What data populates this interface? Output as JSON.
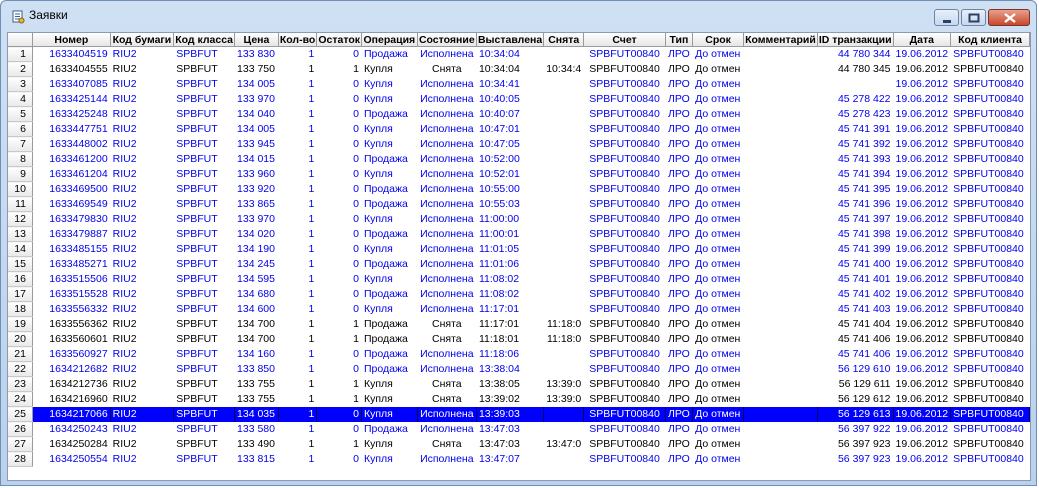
{
  "window": {
    "title": "Заявки"
  },
  "columns": [
    "",
    "Номер",
    "Код бумаги",
    "Код класса",
    "Цена",
    "Кол-во",
    "Остаток",
    "Операция",
    "Состояние",
    "Выставлена",
    "Снята",
    "Счет",
    "Тип",
    "Срок",
    "Комментарий",
    "ID транзакции",
    "Дата",
    "Код клиента"
  ],
  "rows": [
    {
      "n": "1",
      "num": "1633404519",
      "sec": "RIU2",
      "cls": "SPBFUT",
      "price": "133 830",
      "qty": "1",
      "rest": "0",
      "op": "Продажа",
      "state": "Исполнена",
      "placed": "10:34:04",
      "removed": "",
      "acc": "SPBFUT00840",
      "type": "ЛРО",
      "term": "До отмен",
      "comment": "",
      "tid": "44 780 344",
      "date": "19.06.2012",
      "client": "SPBFUT00840",
      "style": "blue"
    },
    {
      "n": "2",
      "num": "1633404555",
      "sec": "RIU2",
      "cls": "SPBFUT",
      "price": "133 750",
      "qty": "1",
      "rest": "1",
      "op": "Купля",
      "state": "Снята",
      "placed": "10:34:04",
      "removed": "10:34:4",
      "acc": "SPBFUT00840",
      "type": "ЛРО",
      "term": "До отмен",
      "comment": "",
      "tid": "44 780 345",
      "date": "19.06.2012",
      "client": "SPBFUT00840",
      "style": "black"
    },
    {
      "n": "3",
      "num": "1633407085",
      "sec": "RIU2",
      "cls": "SPBFUT",
      "price": "134 005",
      "qty": "1",
      "rest": "0",
      "op": "Купля",
      "state": "Исполнена",
      "placed": "10:34:41",
      "removed": "",
      "acc": "SPBFUT00840",
      "type": "ЛРО",
      "term": "До отмен",
      "comment": "",
      "tid": "",
      "date": "19.06.2012",
      "client": "SPBFUT00840",
      "style": "blue"
    },
    {
      "n": "4",
      "num": "1633425144",
      "sec": "RIU2",
      "cls": "SPBFUT",
      "price": "133 970",
      "qty": "1",
      "rest": "0",
      "op": "Купля",
      "state": "Исполнена",
      "placed": "10:40:05",
      "removed": "",
      "acc": "SPBFUT00840",
      "type": "ЛРО",
      "term": "До отмен",
      "comment": "",
      "tid": "45 278 422",
      "date": "19.06.2012",
      "client": "SPBFUT00840",
      "style": "blue"
    },
    {
      "n": "5",
      "num": "1633425248",
      "sec": "RIU2",
      "cls": "SPBFUT",
      "price": "134 040",
      "qty": "1",
      "rest": "0",
      "op": "Продажа",
      "state": "Исполнена",
      "placed": "10:40:07",
      "removed": "",
      "acc": "SPBFUT00840",
      "type": "ЛРО",
      "term": "До отмен",
      "comment": "",
      "tid": "45 278 423",
      "date": "19.06.2012",
      "client": "SPBFUT00840",
      "style": "blue"
    },
    {
      "n": "6",
      "num": "1633447751",
      "sec": "RIU2",
      "cls": "SPBFUT",
      "price": "134 005",
      "qty": "1",
      "rest": "0",
      "op": "Купля",
      "state": "Исполнена",
      "placed": "10:47:01",
      "removed": "",
      "acc": "SPBFUT00840",
      "type": "ЛРО",
      "term": "До отмен",
      "comment": "",
      "tid": "45 741 391",
      "date": "19.06.2012",
      "client": "SPBFUT00840",
      "style": "blue"
    },
    {
      "n": "7",
      "num": "1633448002",
      "sec": "RIU2",
      "cls": "SPBFUT",
      "price": "133 945",
      "qty": "1",
      "rest": "0",
      "op": "Купля",
      "state": "Исполнена",
      "placed": "10:47:05",
      "removed": "",
      "acc": "SPBFUT00840",
      "type": "ЛРО",
      "term": "До отмен",
      "comment": "",
      "tid": "45 741 392",
      "date": "19.06.2012",
      "client": "SPBFUT00840",
      "style": "blue"
    },
    {
      "n": "8",
      "num": "1633461200",
      "sec": "RIU2",
      "cls": "SPBFUT",
      "price": "134 015",
      "qty": "1",
      "rest": "0",
      "op": "Продажа",
      "state": "Исполнена",
      "placed": "10:52:00",
      "removed": "",
      "acc": "SPBFUT00840",
      "type": "ЛРО",
      "term": "До отмен",
      "comment": "",
      "tid": "45 741 393",
      "date": "19.06.2012",
      "client": "SPBFUT00840",
      "style": "blue"
    },
    {
      "n": "9",
      "num": "1633461204",
      "sec": "RIU2",
      "cls": "SPBFUT",
      "price": "133 960",
      "qty": "1",
      "rest": "0",
      "op": "Купля",
      "state": "Исполнена",
      "placed": "10:52:01",
      "removed": "",
      "acc": "SPBFUT00840",
      "type": "ЛРО",
      "term": "До отмен",
      "comment": "",
      "tid": "45 741 394",
      "date": "19.06.2012",
      "client": "SPBFUT00840",
      "style": "blue"
    },
    {
      "n": "10",
      "num": "1633469500",
      "sec": "RIU2",
      "cls": "SPBFUT",
      "price": "133 920",
      "qty": "1",
      "rest": "0",
      "op": "Продажа",
      "state": "Исполнена",
      "placed": "10:55:00",
      "removed": "",
      "acc": "SPBFUT00840",
      "type": "ЛРО",
      "term": "До отмен",
      "comment": "",
      "tid": "45 741 395",
      "date": "19.06.2012",
      "client": "SPBFUT00840",
      "style": "blue"
    },
    {
      "n": "11",
      "num": "1633469549",
      "sec": "RIU2",
      "cls": "SPBFUT",
      "price": "133 865",
      "qty": "1",
      "rest": "0",
      "op": "Продажа",
      "state": "Исполнена",
      "placed": "10:55:03",
      "removed": "",
      "acc": "SPBFUT00840",
      "type": "ЛРО",
      "term": "До отмен",
      "comment": "",
      "tid": "45 741 396",
      "date": "19.06.2012",
      "client": "SPBFUT00840",
      "style": "blue"
    },
    {
      "n": "12",
      "num": "1633479830",
      "sec": "RIU2",
      "cls": "SPBFUT",
      "price": "133 970",
      "qty": "1",
      "rest": "0",
      "op": "Купля",
      "state": "Исполнена",
      "placed": "11:00:00",
      "removed": "",
      "acc": "SPBFUT00840",
      "type": "ЛРО",
      "term": "До отмен",
      "comment": "",
      "tid": "45 741 397",
      "date": "19.06.2012",
      "client": "SPBFUT00840",
      "style": "blue"
    },
    {
      "n": "13",
      "num": "1633479887",
      "sec": "RIU2",
      "cls": "SPBFUT",
      "price": "134 020",
      "qty": "1",
      "rest": "0",
      "op": "Продажа",
      "state": "Исполнена",
      "placed": "11:00:01",
      "removed": "",
      "acc": "SPBFUT00840",
      "type": "ЛРО",
      "term": "До отмен",
      "comment": "",
      "tid": "45 741 398",
      "date": "19.06.2012",
      "client": "SPBFUT00840",
      "style": "blue"
    },
    {
      "n": "14",
      "num": "1633485155",
      "sec": "RIU2",
      "cls": "SPBFUT",
      "price": "134 190",
      "qty": "1",
      "rest": "0",
      "op": "Купля",
      "state": "Исполнена",
      "placed": "11:01:05",
      "removed": "",
      "acc": "SPBFUT00840",
      "type": "ЛРО",
      "term": "До отмен",
      "comment": "",
      "tid": "45 741 399",
      "date": "19.06.2012",
      "client": "SPBFUT00840",
      "style": "blue"
    },
    {
      "n": "15",
      "num": "1633485271",
      "sec": "RIU2",
      "cls": "SPBFUT",
      "price": "134 245",
      "qty": "1",
      "rest": "0",
      "op": "Продажа",
      "state": "Исполнена",
      "placed": "11:01:06",
      "removed": "",
      "acc": "SPBFUT00840",
      "type": "ЛРО",
      "term": "До отмен",
      "comment": "",
      "tid": "45 741 400",
      "date": "19.06.2012",
      "client": "SPBFUT00840",
      "style": "blue"
    },
    {
      "n": "16",
      "num": "1633515506",
      "sec": "RIU2",
      "cls": "SPBFUT",
      "price": "134 595",
      "qty": "1",
      "rest": "0",
      "op": "Купля",
      "state": "Исполнена",
      "placed": "11:08:02",
      "removed": "",
      "acc": "SPBFUT00840",
      "type": "ЛРО",
      "term": "До отмен",
      "comment": "",
      "tid": "45 741 401",
      "date": "19.06.2012",
      "client": "SPBFUT00840",
      "style": "blue"
    },
    {
      "n": "17",
      "num": "1633515528",
      "sec": "RIU2",
      "cls": "SPBFUT",
      "price": "134 680",
      "qty": "1",
      "rest": "0",
      "op": "Продажа",
      "state": "Исполнена",
      "placed": "11:08:02",
      "removed": "",
      "acc": "SPBFUT00840",
      "type": "ЛРО",
      "term": "До отмен",
      "comment": "",
      "tid": "45 741 402",
      "date": "19.06.2012",
      "client": "SPBFUT00840",
      "style": "blue"
    },
    {
      "n": "18",
      "num": "1633556332",
      "sec": "RIU2",
      "cls": "SPBFUT",
      "price": "134 600",
      "qty": "1",
      "rest": "0",
      "op": "Купля",
      "state": "Исполнена",
      "placed": "11:17:01",
      "removed": "",
      "acc": "SPBFUT00840",
      "type": "ЛРО",
      "term": "До отмен",
      "comment": "",
      "tid": "45 741 403",
      "date": "19.06.2012",
      "client": "SPBFUT00840",
      "style": "blue"
    },
    {
      "n": "19",
      "num": "1633556362",
      "sec": "RIU2",
      "cls": "SPBFUT",
      "price": "134 700",
      "qty": "1",
      "rest": "1",
      "op": "Продажа",
      "state": "Снята",
      "placed": "11:17:01",
      "removed": "11:18:0",
      "acc": "SPBFUT00840",
      "type": "ЛРО",
      "term": "До отмен",
      "comment": "",
      "tid": "45 741 404",
      "date": "19.06.2012",
      "client": "SPBFUT00840",
      "style": "black"
    },
    {
      "n": "20",
      "num": "1633560601",
      "sec": "RIU2",
      "cls": "SPBFUT",
      "price": "134 700",
      "qty": "1",
      "rest": "1",
      "op": "Продажа",
      "state": "Снята",
      "placed": "11:18:01",
      "removed": "11:18:0",
      "acc": "SPBFUT00840",
      "type": "ЛРО",
      "term": "До отмен",
      "comment": "",
      "tid": "45 741 406",
      "date": "19.06.2012",
      "client": "SPBFUT00840",
      "style": "black"
    },
    {
      "n": "21",
      "num": "1633560927",
      "sec": "RIU2",
      "cls": "SPBFUT",
      "price": "134 160",
      "qty": "1",
      "rest": "0",
      "op": "Продажа",
      "state": "Исполнена",
      "placed": "11:18:06",
      "removed": "",
      "acc": "SPBFUT00840",
      "type": "ЛРО",
      "term": "До отмен",
      "comment": "",
      "tid": "45 741 406",
      "date": "19.06.2012",
      "client": "SPBFUT00840",
      "style": "blue"
    },
    {
      "n": "22",
      "num": "1634212682",
      "sec": "RIU2",
      "cls": "SPBFUT",
      "price": "133 850",
      "qty": "1",
      "rest": "0",
      "op": "Продажа",
      "state": "Исполнена",
      "placed": "13:38:04",
      "removed": "",
      "acc": "SPBFUT00840",
      "type": "ЛРО",
      "term": "До отмен",
      "comment": "",
      "tid": "56 129 610",
      "date": "19.06.2012",
      "client": "SPBFUT00840",
      "style": "blue"
    },
    {
      "n": "23",
      "num": "1634212736",
      "sec": "RIU2",
      "cls": "SPBFUT",
      "price": "133 755",
      "qty": "1",
      "rest": "1",
      "op": "Купля",
      "state": "Снята",
      "placed": "13:38:05",
      "removed": "13:39:0",
      "acc": "SPBFUT00840",
      "type": "ЛРО",
      "term": "До отмен",
      "comment": "",
      "tid": "56 129 611",
      "date": "19.06.2012",
      "client": "SPBFUT00840",
      "style": "black"
    },
    {
      "n": "24",
      "num": "1634216960",
      "sec": "RIU2",
      "cls": "SPBFUT",
      "price": "133 755",
      "qty": "1",
      "rest": "1",
      "op": "Купля",
      "state": "Снята",
      "placed": "13:39:02",
      "removed": "13:39:0",
      "acc": "SPBFUT00840",
      "type": "ЛРО",
      "term": "До отмен",
      "comment": "",
      "tid": "56 129 612",
      "date": "19.06.2012",
      "client": "SPBFUT00840",
      "style": "black"
    },
    {
      "n": "25",
      "num": "1634217066",
      "sec": "RIU2",
      "cls": "SPBFUT",
      "price": "134 035",
      "qty": "1",
      "rest": "0",
      "op": "Купля",
      "state": "Исполнена",
      "placed": "13:39:03",
      "removed": "",
      "acc": "SPBFUT00840",
      "type": "ЛРО",
      "term": "До отмен",
      "comment": "",
      "tid": "56 129 613",
      "date": "19.06.2012",
      "client": "SPBFUT00840",
      "style": "sel"
    },
    {
      "n": "26",
      "num": "1634250243",
      "sec": "RIU2",
      "cls": "SPBFUT",
      "price": "133 580",
      "qty": "1",
      "rest": "0",
      "op": "Продажа",
      "state": "Исполнена",
      "placed": "13:47:03",
      "removed": "",
      "acc": "SPBFUT00840",
      "type": "ЛРО",
      "term": "До отмен",
      "comment": "",
      "tid": "56 397 922",
      "date": "19.06.2012",
      "client": "SPBFUT00840",
      "style": "blue"
    },
    {
      "n": "27",
      "num": "1634250284",
      "sec": "RIU2",
      "cls": "SPBFUT",
      "price": "133 490",
      "qty": "1",
      "rest": "1",
      "op": "Купля",
      "state": "Снята",
      "placed": "13:47:03",
      "removed": "13:47:0",
      "acc": "SPBFUT00840",
      "type": "ЛРО",
      "term": "До отмен",
      "comment": "",
      "tid": "56 397 923",
      "date": "19.06.2012",
      "client": "SPBFUT00840",
      "style": "black"
    },
    {
      "n": "28",
      "num": "1634250554",
      "sec": "RIU2",
      "cls": "SPBFUT",
      "price": "133 815",
      "qty": "1",
      "rest": "0",
      "op": "Купля",
      "state": "Исполнена",
      "placed": "13:47:07",
      "removed": "",
      "acc": "SPBFUT00840",
      "type": "ЛРО",
      "term": "До отмен",
      "comment": "",
      "tid": "56 397 923",
      "date": "19.06.2012",
      "client": "SPBFUT00840",
      "style": "blue"
    }
  ],
  "colors": {
    "executed_text": "#0000ee",
    "cancelled_text": "#000000",
    "selection": "#0000ff"
  }
}
